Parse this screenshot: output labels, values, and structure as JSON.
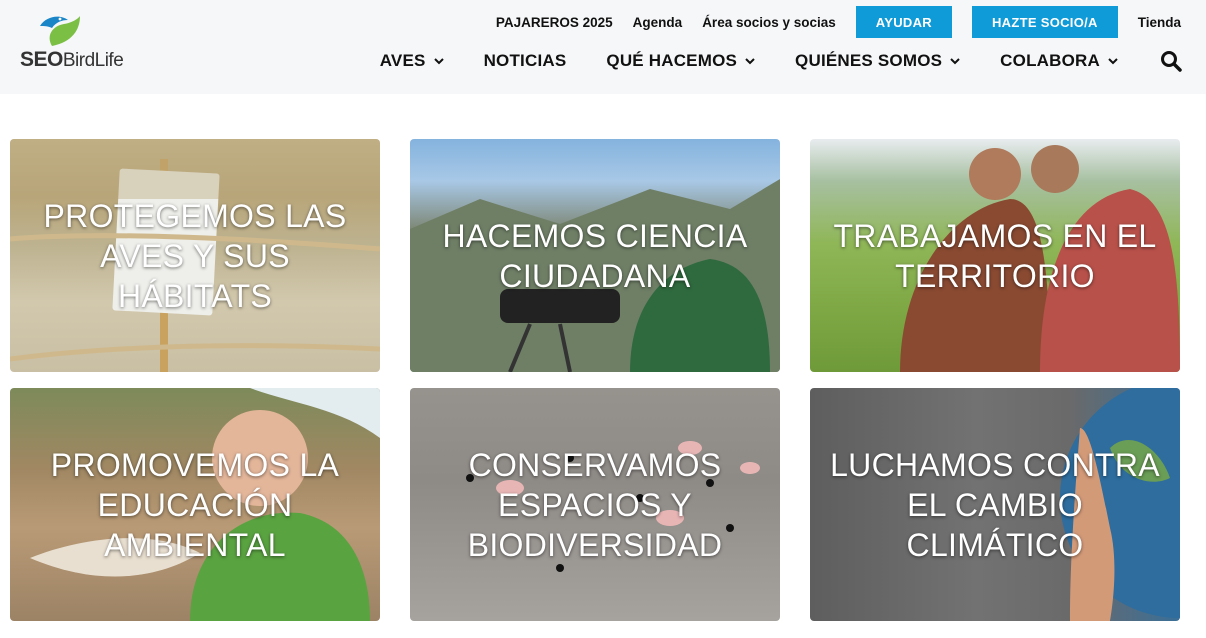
{
  "brand": {
    "logo_text_bold": "SEO",
    "logo_text_light": "BirdLife",
    "colors": {
      "accent": "#0f9ad8",
      "leaf": "#7bbf45",
      "bird": "#1a86c7"
    }
  },
  "topbar": {
    "links": [
      "PAJAREROS 2025",
      "Agenda",
      "Área socios y socias"
    ],
    "buttons": [
      "AYUDAR",
      "HAZTE SOCIO/A"
    ],
    "shop": "Tienda"
  },
  "nav": {
    "items": [
      {
        "label": "AVES",
        "dropdown": true
      },
      {
        "label": "NOTICIAS",
        "dropdown": false
      },
      {
        "label": "QUÉ HACEMOS",
        "dropdown": true
      },
      {
        "label": "QUIÉNES SOMOS",
        "dropdown": true
      },
      {
        "label": "COLABORA",
        "dropdown": true
      }
    ],
    "search_icon": "search-icon"
  },
  "tiles": [
    {
      "label": "PROTEGEMOS LAS AVES Y SUS HÁBITATS"
    },
    {
      "label": "HACEMOS CIENCIA CIUDADANA"
    },
    {
      "label": "TRABAJAMOS EN EL TERRITORIO"
    },
    {
      "label": "PROMOVEMOS LA EDUCACIÓN AMBIENTAL"
    },
    {
      "label": "CONSERVAMOS ESPACIOS Y BIODIVERSIDAD"
    },
    {
      "label": "LUCHAMOS CONTRA EL CAMBIO CLIMÁTICO"
    }
  ]
}
